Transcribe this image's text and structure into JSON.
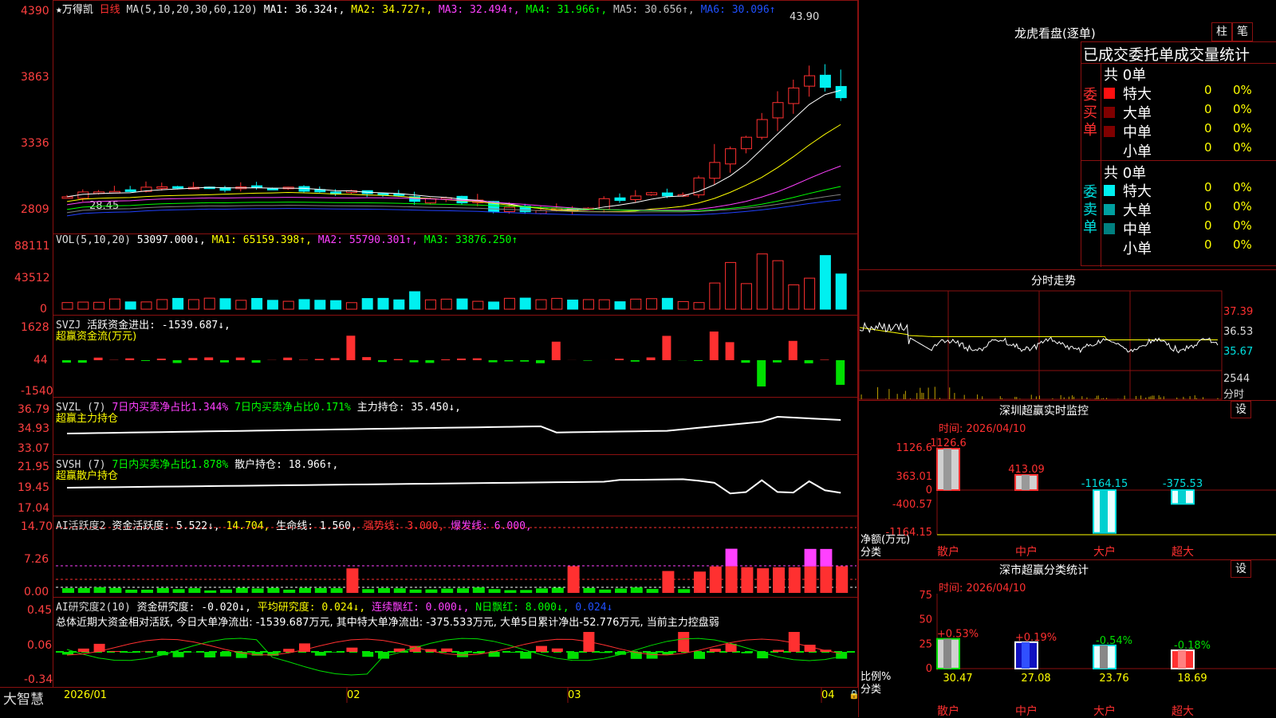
{
  "colors": {
    "up": "#ff3030",
    "down": "#00f0f0",
    "grid": "#8a1010",
    "ma1": "#ffffff",
    "ma2": "#ffff00",
    "ma3": "#ff40ff",
    "ma4": "#00ff00",
    "ma5": "#808080",
    "ma6": "#2040ff"
  },
  "price_panel": {
    "stock": "★万得凯",
    "period": "日线",
    "ma_head": "MA(5,10,20,30,60,120)",
    "ma1": "MA1: 36.324↑,",
    "ma2": "MA2: 34.727↑,",
    "ma3": "MA3: 32.494↑,",
    "ma4": "MA4: 31.966↑,",
    "ma5": "MA5: 30.656↑,",
    "ma6": "MA6: 30.096↑",
    "y_ticks": [
      "4390",
      "3863",
      "3336",
      "2809"
    ],
    "high_label": "43.90",
    "low_label": "28.45"
  },
  "vol_panel": {
    "head": "VOL(5,10,20)",
    "v0": "53097.000↓,",
    "ma1": "MA1: 65159.398↑,",
    "ma2": "MA2: 55790.301↑,",
    "ma3": "MA3: 33876.250↑",
    "y_ticks": [
      "88111",
      "43512",
      "0"
    ]
  },
  "svzj_panel": {
    "head": "SVZJ",
    "text": "活跃资金进出: -1539.687↓,",
    "sub": "超赢资金流(万元)",
    "y_ticks": [
      "1628",
      "44",
      "-1540"
    ]
  },
  "svzl_panel": {
    "head": "SVZL  (7)",
    "a": "7日内买卖净占比1.344%",
    "b": "7日内买卖净占比0.171%",
    "c": "主力持仓: 35.450↓,",
    "sub": "超赢主力持仓",
    "y_ticks": [
      "36.79",
      "34.93",
      "33.07"
    ]
  },
  "svsh_panel": {
    "head": "SVSH  (7)",
    "a": "7日内买卖净占比1.878%",
    "c": "散户持仓: 18.966↑,",
    "sub": "超赢散户持仓",
    "y_ticks": [
      "21.95",
      "19.45",
      "17.04"
    ]
  },
  "ai_panel": {
    "head": "AI活跃度2",
    "a": "资金活跃度: 5.522↓,",
    "b": "14.704,",
    "c": "生命线: 1.560,",
    "d": "强势线: 3.000,",
    "e": "爆发线: 6.000,",
    "y_ticks": [
      "14.70",
      "7.26",
      "0.00"
    ]
  },
  "research_panel": {
    "head": "AI研究度2(10)",
    "a": "资金研究度: -0.020↓,",
    "b": "平均研究度: 0.024↓,",
    "c": "连续飘红: 0.000↓,",
    "d": "N日飘红: 8.000↓,",
    "e": "0.024↓",
    "summary": "总体近期大资金相对活跃, 今日大单净流出: -1539.687万元, 其中特大单净流出: -375.533万元, 大单5日累计净出-52.776万元, 当前主力控盘弱",
    "y_ticks": [
      "0.45",
      "0.06",
      "-0.34"
    ]
  },
  "bottom_bar": {
    "brand": "大智慧",
    "months": [
      "2026/01",
      "02",
      "03",
      "04"
    ]
  },
  "right": {
    "dragon_title": "龙虎看盘(逐单)",
    "btn1": "柱",
    "btn2": "笔",
    "table_head": "已成交委托单成交量统计",
    "buy_total": "共 0单",
    "sell_total": "共 0单",
    "buy_label": "委买单",
    "sell_label": "委卖单",
    "rows": [
      {
        "name": "特大",
        "count": "0",
        "pct": "0%"
      },
      {
        "name": "大单",
        "count": "0",
        "pct": "0%"
      },
      {
        "name": "中单",
        "count": "0",
        "pct": "0%"
      },
      {
        "name": "小单",
        "count": "0",
        "pct": "0%"
      }
    ],
    "intraday_title": "分时走势",
    "intraday_ticks": [
      "37.39",
      "36.53",
      "35.67",
      "2544",
      "分时"
    ],
    "sz_monitor_title": "深圳超赢实时监控",
    "sz_monitor_btn": "设",
    "sz_monitor_time": "时间: 2026/04/10",
    "sz_monitor_ticks": [
      "1126.6",
      "363.01",
      "0",
      "-400.57",
      "-1164.15"
    ],
    "sz_monitor_values": [
      "1126.6",
      "413.09",
      "-1164.15",
      "-375.53"
    ],
    "sz_monitor_bar_values": [
      1126.6,
      413.09,
      -1164.15,
      -375.53
    ],
    "sz_monitor_ylabel": "净额(万元)",
    "sz_monitor_xlabel": "分类",
    "categories": [
      "散户",
      "中户",
      "大户",
      "超大"
    ],
    "sz_class_title": "深市超赢分类统计",
    "sz_class_btn": "设",
    "sz_class_time": "时间: 2026/04/10",
    "sz_class_ticks": [
      "75",
      "50",
      "25",
      "0"
    ],
    "sz_class_changes": [
      "+0.53%",
      "+0.19%",
      "-0.54%",
      "-0.18%"
    ],
    "sz_class_values": [
      "30.47",
      "27.08",
      "23.76",
      "18.69"
    ],
    "sz_class_ylabel": "比例%",
    "sz_class_xlabel": "分类"
  }
}
